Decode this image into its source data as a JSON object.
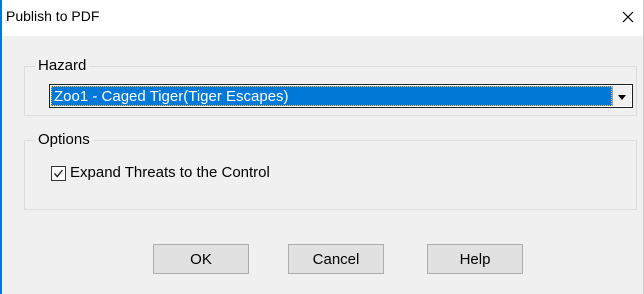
{
  "window": {
    "title": "Publish to PDF"
  },
  "hazard_group": {
    "legend": "Hazard",
    "selected_value": "Zoo1 - Caged Tiger(Tiger Escapes)"
  },
  "options_group": {
    "legend": "Options",
    "expand_threats": {
      "label": "Expand Threats to the Control",
      "checked": true
    }
  },
  "buttons": {
    "ok": "OK",
    "cancel": "Cancel",
    "help": "Help"
  },
  "icons": {
    "close": "close-icon",
    "dropdown": "chevron-down-icon",
    "check": "checkmark-icon"
  },
  "colors": {
    "selection": "#0078d7",
    "accent_border": "#0078d7"
  }
}
